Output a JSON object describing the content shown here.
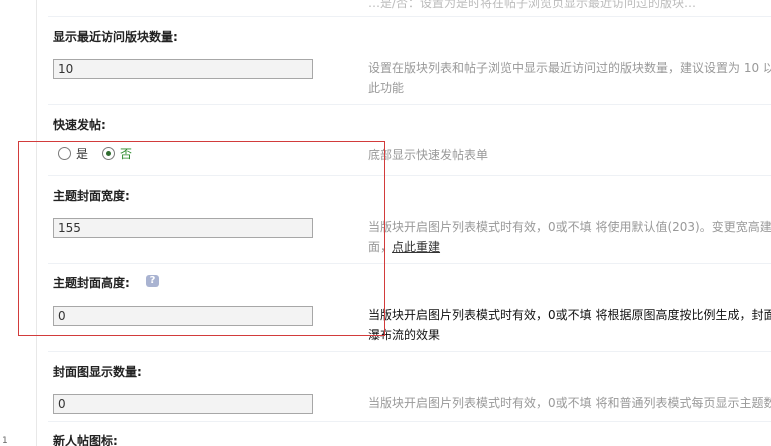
{
  "top_tip_partial": "…是/否：设置为是时将在帖子浏览页显示最近访问过的版块…",
  "recent_forums": {
    "title": "显示最近访问版块数量:",
    "value": "10",
    "tip_line1": "设置在版块列表和帖子浏览中显示最近访问过的版块数量，建议设置为 10 以",
    "tip_line2": "此功能"
  },
  "quick_post": {
    "title": "快速发帖:",
    "option_yes": "是",
    "option_no": "否",
    "selected": "否",
    "tip": "底部显示快速发帖表单"
  },
  "cover_width": {
    "title": "主题封面宽度:",
    "value": "155",
    "tip_line1": "当版块开启图片列表模式时有效，0或不填 将使用默认值(203)。变更宽高建",
    "tip_line2_prefix": "面，",
    "tip_link": "点此重建"
  },
  "cover_height": {
    "title": "主题封面高度:",
    "help_icon": "?",
    "value": "0",
    "tip_line1": "当版块开启图片列表模式时有效，0或不填 将根据原图高度按比例生成，封面",
    "tip_line2": "瀑布流的效果"
  },
  "cover_count": {
    "title": "封面图显示数量:",
    "value": "0",
    "tip_line1": "当版块开启图片列表模式时有效，0或不填 将和普通列表模式每页显示主题数"
  },
  "new_user_icon": {
    "title": "新人帖图标:"
  },
  "gutter_number": "1"
}
